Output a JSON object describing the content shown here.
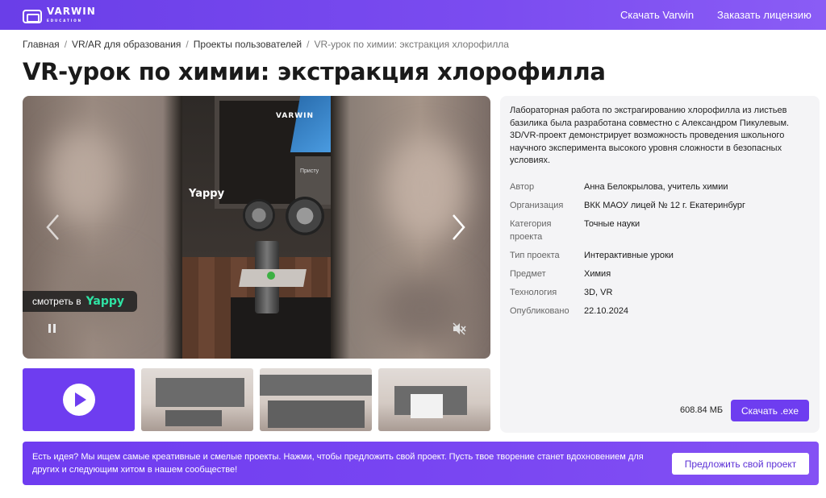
{
  "header": {
    "logo_text": "VARWIN",
    "logo_sub": "EDUCATION",
    "nav": {
      "download": "Скачать Varwin",
      "license": "Заказать лицензию"
    }
  },
  "breadcrumb": {
    "items": [
      "Главная",
      "VR/AR для образования",
      "Проекты пользователей",
      "VR-урок по химии: экстракция хлорофилла"
    ]
  },
  "page_title": "VR-урок по химии: экстракция хлорофилла",
  "player": {
    "brand": "VARWIN",
    "overlay_brand": "Yappy",
    "panel_text": "Присту",
    "watch_label": "смотреть в",
    "watch_brand": "Yappy"
  },
  "info": {
    "description": "Лабораторная работа по экстрагированию хлорофилла из листьев базилика была разработана совместно с Александром Пикулевым. 3D/VR-проект демонстрирует возможность проведения школьного научного эксперимента высокого уровня сложности в безопасных условиях.",
    "meta": [
      {
        "key": "Автор",
        "value": "Анна Белокрылова, учитель химии"
      },
      {
        "key": "Организация",
        "value": "ВКК МАОУ лицей № 12 г. Екатеринбург"
      },
      {
        "key": "Категория проекта",
        "value": "Точные науки"
      },
      {
        "key": "Тип проекта",
        "value": "Интерактивные уроки"
      },
      {
        "key": "Предмет",
        "value": "Химия"
      },
      {
        "key": "Технология",
        "value": "3D, VR"
      },
      {
        "key": "Опубликовано",
        "value": "22.10.2024"
      }
    ],
    "size": "608.84 МБ",
    "download_label": "Скачать .exe"
  },
  "banner": {
    "text": "Есть идея? Мы ищем самые креативные и смелые проекты. Нажми, чтобы предложить свой проект. Пусть твое творение станет вдохновением для других и следующим хитом в нашем сообществе!",
    "button_label": "Предложить свой проект"
  },
  "colors": {
    "accent": "#6e3df0",
    "yappy_green": "#2fe3a4"
  }
}
